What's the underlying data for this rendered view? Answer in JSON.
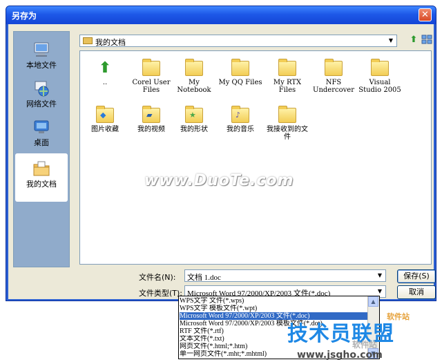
{
  "window": {
    "title": "另存为",
    "close_glyph": "✕"
  },
  "places": [
    {
      "label": "本地文件",
      "icon": "computer-icon"
    },
    {
      "label": "网络文件",
      "icon": "network-icon"
    },
    {
      "label": "桌面",
      "icon": "desktop-icon"
    },
    {
      "label": "我的文档",
      "icon": "my-documents-icon"
    }
  ],
  "lookin": {
    "value": "我的文档"
  },
  "files": [
    {
      "label": "..",
      "icon": "up-folder-icon"
    },
    {
      "label": "Corel User Files",
      "icon": "folder-icon"
    },
    {
      "label": "My Notebook",
      "icon": "folder-icon"
    },
    {
      "label": "My QQ Files",
      "icon": "folder-icon"
    },
    {
      "label": "My RTX Files",
      "icon": "folder-icon"
    },
    {
      "label": "NFS Undercover",
      "icon": "folder-icon"
    },
    {
      "label": "Visual Studio 2005",
      "icon": "folder-icon"
    },
    {
      "label": "图片收藏",
      "icon": "pictures-folder-icon"
    },
    {
      "label": "我的视频",
      "icon": "videos-folder-icon"
    },
    {
      "label": "我的形状",
      "icon": "shapes-folder-icon"
    },
    {
      "label": "我的音乐",
      "icon": "music-folder-icon"
    },
    {
      "label": "我接收到的文件",
      "icon": "folder-icon"
    }
  ],
  "watermark": "www.DuoTe.com",
  "form": {
    "filename_label": "文件名(N):",
    "filename_value": "文档 1.doc",
    "filetype_label": "文件类型(T):",
    "filetype_value": "Microsoft Word 97/2000/XP/2003 文件(*.doc)",
    "save_label": "保存(S)",
    "cancel_label": "取消"
  },
  "filetype_options": [
    "WPS文字 文件(*.wps)",
    "WPS文字 模板文件(*.wpt)",
    "Microsoft Word 97/2000/XP/2003 文件(*.doc)",
    "Microsoft Word 97/2000/XP/2003 模板文件(*.dot)",
    "RTF 文件(*.rtf)",
    "文本文件(*.txt)",
    "网页文件(*.html;*.htm)",
    "单一网页文件(*.mht;*.mhtml)"
  ],
  "selected_option_index": 2,
  "brand": {
    "logo_text": "技术员联盟",
    "tag_top": "软件站",
    "tag_mid": "软件站",
    "url": "www.jsgho.com"
  }
}
